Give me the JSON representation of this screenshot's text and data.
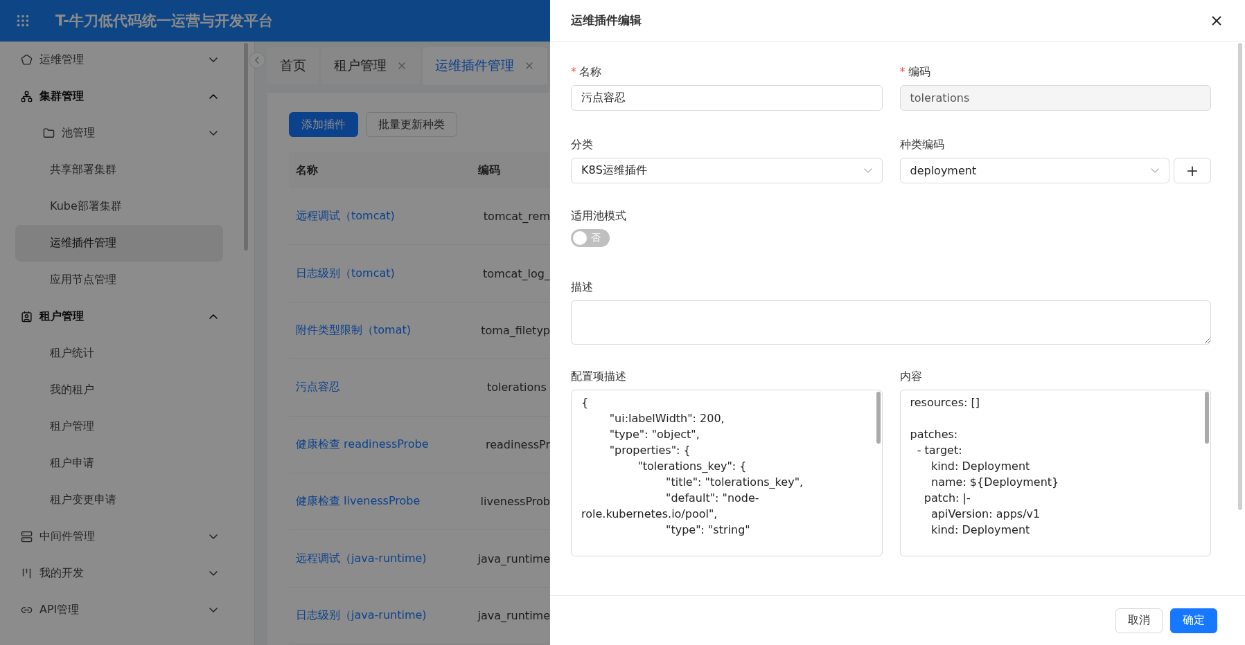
{
  "app": {
    "title": "T-牛刀低代码统一运营与开发平台"
  },
  "sidebar": {
    "items": [
      {
        "label": "运维管理",
        "expanded": false
      },
      {
        "label": "集群管理",
        "expanded": true,
        "children": [
          {
            "label": "池管理",
            "expanded": false,
            "kind": "folder"
          },
          {
            "label": "共享部署集群",
            "selected": false
          },
          {
            "label": "Kube部署集群",
            "selected": false
          },
          {
            "label": "运维插件管理",
            "selected": true
          },
          {
            "label": "应用节点管理",
            "selected": false
          }
        ]
      },
      {
        "label": "租户管理",
        "expanded": true,
        "children": [
          {
            "label": "租户统计",
            "selected": false
          },
          {
            "label": "我的租户",
            "selected": false
          },
          {
            "label": "租户管理",
            "selected": false
          },
          {
            "label": "租户申请",
            "selected": false
          },
          {
            "label": "租户变更申请",
            "selected": false
          }
        ]
      },
      {
        "label": "中间件管理",
        "expanded": false
      },
      {
        "label": "我的开发",
        "expanded": false
      },
      {
        "label": "API管理",
        "expanded": false
      }
    ]
  },
  "tabs": [
    {
      "label": "首页",
      "selected": false,
      "closable": false
    },
    {
      "label": "租户管理",
      "selected": false,
      "closable": true
    },
    {
      "label": "运维插件管理",
      "selected": true,
      "closable": true
    }
  ],
  "toolbar": {
    "buttons": [
      {
        "label": "添加插件",
        "kind": "primary"
      },
      {
        "label": "批量更新种类",
        "kind": "default"
      }
    ]
  },
  "table": {
    "columns": [
      "名称",
      "编码"
    ],
    "rows": [
      {
        "name": "远程调试（tomcat)",
        "code": "tomcat_rem"
      },
      {
        "name": "日志级别（tomcat)",
        "code": "tomcat_log_"
      },
      {
        "name": "附件类型限制（tomat)",
        "code": "toma_filetyp"
      },
      {
        "name": "污点容忍",
        "code": "tolerations"
      },
      {
        "name": "健康检查 readinessProbe",
        "code": "readinessPr"
      },
      {
        "name": "健康检查 livenessProbe",
        "code": "livenessProb"
      },
      {
        "name": "远程调试（java-runtime)",
        "code": "java_runtime"
      },
      {
        "name": "日志级别（java-runtime)",
        "code": "java_runtime"
      }
    ]
  },
  "drawer": {
    "title": "运维插件编辑",
    "name": {
      "label": "名称",
      "required_mark": "*",
      "value": "污点容忍",
      "disabled": false
    },
    "code": {
      "label": "编码",
      "required_mark": "*",
      "value": "tolerations",
      "disabled": true
    },
    "category": {
      "label": "分类",
      "value": "K8S运维插件"
    },
    "kind_code": {
      "label": "种类编码",
      "value": "deployment",
      "add_button": "+"
    },
    "pool_mode": {
      "label": "适用池模式",
      "on": false,
      "text": "否"
    },
    "description": {
      "label": "描述"
    },
    "config_desc": {
      "label": "配置项描述",
      "lines": [
        "{",
        "\t\"ui:labelWidth\": 200,",
        "\t\"type\": \"object\",",
        "\t\"properties\": {",
        "\t\t\"tolerations_key\": {",
        "\t\t\t\"title\": \"tolerations_key\",",
        "\t\t\t\"default\": \"node-role.kubernetes.io/pool\",",
        "\t\t\t\"type\": \"string\""
      ]
    },
    "content": {
      "label": "内容",
      "lines": [
        "resources: []"
      ],
      "more_lines": [
        "patches:",
        "  - target:",
        "      kind: Deployment",
        "      name: ${Deployment}",
        "    patch: |-",
        "      apiVersion: apps/v1",
        "      kind: Deployment"
      ]
    },
    "buttons": [
      {
        "label": "取消",
        "kind": "default"
      },
      {
        "label": "确定",
        "kind": "primary"
      }
    ]
  }
}
